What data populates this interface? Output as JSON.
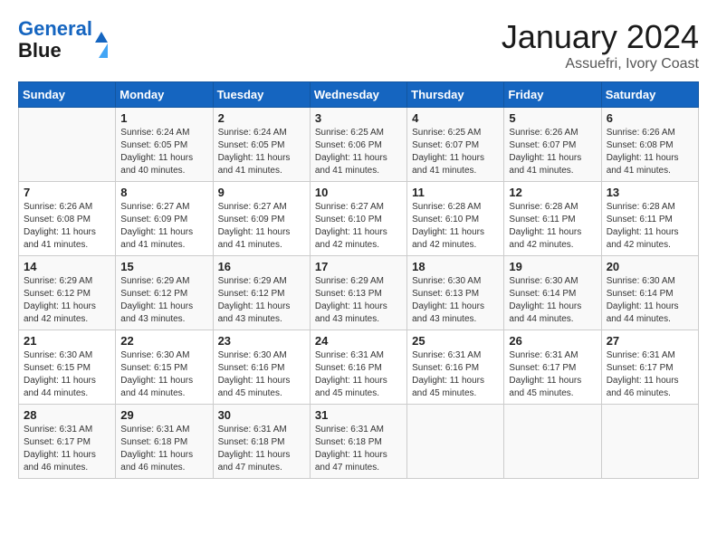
{
  "logo": {
    "line1": "General",
    "line2": "Blue"
  },
  "title": "January 2024",
  "subtitle": "Assuefri, Ivory Coast",
  "headers": [
    "Sunday",
    "Monday",
    "Tuesday",
    "Wednesday",
    "Thursday",
    "Friday",
    "Saturday"
  ],
  "weeks": [
    [
      {
        "day": "",
        "info": ""
      },
      {
        "day": "1",
        "info": "Sunrise: 6:24 AM\nSunset: 6:05 PM\nDaylight: 11 hours\nand 40 minutes."
      },
      {
        "day": "2",
        "info": "Sunrise: 6:24 AM\nSunset: 6:05 PM\nDaylight: 11 hours\nand 41 minutes."
      },
      {
        "day": "3",
        "info": "Sunrise: 6:25 AM\nSunset: 6:06 PM\nDaylight: 11 hours\nand 41 minutes."
      },
      {
        "day": "4",
        "info": "Sunrise: 6:25 AM\nSunset: 6:07 PM\nDaylight: 11 hours\nand 41 minutes."
      },
      {
        "day": "5",
        "info": "Sunrise: 6:26 AM\nSunset: 6:07 PM\nDaylight: 11 hours\nand 41 minutes."
      },
      {
        "day": "6",
        "info": "Sunrise: 6:26 AM\nSunset: 6:08 PM\nDaylight: 11 hours\nand 41 minutes."
      }
    ],
    [
      {
        "day": "7",
        "info": "Sunrise: 6:26 AM\nSunset: 6:08 PM\nDaylight: 11 hours\nand 41 minutes."
      },
      {
        "day": "8",
        "info": "Sunrise: 6:27 AM\nSunset: 6:09 PM\nDaylight: 11 hours\nand 41 minutes."
      },
      {
        "day": "9",
        "info": "Sunrise: 6:27 AM\nSunset: 6:09 PM\nDaylight: 11 hours\nand 41 minutes."
      },
      {
        "day": "10",
        "info": "Sunrise: 6:27 AM\nSunset: 6:10 PM\nDaylight: 11 hours\nand 42 minutes."
      },
      {
        "day": "11",
        "info": "Sunrise: 6:28 AM\nSunset: 6:10 PM\nDaylight: 11 hours\nand 42 minutes."
      },
      {
        "day": "12",
        "info": "Sunrise: 6:28 AM\nSunset: 6:11 PM\nDaylight: 11 hours\nand 42 minutes."
      },
      {
        "day": "13",
        "info": "Sunrise: 6:28 AM\nSunset: 6:11 PM\nDaylight: 11 hours\nand 42 minutes."
      }
    ],
    [
      {
        "day": "14",
        "info": "Sunrise: 6:29 AM\nSunset: 6:12 PM\nDaylight: 11 hours\nand 42 minutes."
      },
      {
        "day": "15",
        "info": "Sunrise: 6:29 AM\nSunset: 6:12 PM\nDaylight: 11 hours\nand 43 minutes."
      },
      {
        "day": "16",
        "info": "Sunrise: 6:29 AM\nSunset: 6:12 PM\nDaylight: 11 hours\nand 43 minutes."
      },
      {
        "day": "17",
        "info": "Sunrise: 6:29 AM\nSunset: 6:13 PM\nDaylight: 11 hours\nand 43 minutes."
      },
      {
        "day": "18",
        "info": "Sunrise: 6:30 AM\nSunset: 6:13 PM\nDaylight: 11 hours\nand 43 minutes."
      },
      {
        "day": "19",
        "info": "Sunrise: 6:30 AM\nSunset: 6:14 PM\nDaylight: 11 hours\nand 44 minutes."
      },
      {
        "day": "20",
        "info": "Sunrise: 6:30 AM\nSunset: 6:14 PM\nDaylight: 11 hours\nand 44 minutes."
      }
    ],
    [
      {
        "day": "21",
        "info": "Sunrise: 6:30 AM\nSunset: 6:15 PM\nDaylight: 11 hours\nand 44 minutes."
      },
      {
        "day": "22",
        "info": "Sunrise: 6:30 AM\nSunset: 6:15 PM\nDaylight: 11 hours\nand 44 minutes."
      },
      {
        "day": "23",
        "info": "Sunrise: 6:30 AM\nSunset: 6:16 PM\nDaylight: 11 hours\nand 45 minutes."
      },
      {
        "day": "24",
        "info": "Sunrise: 6:31 AM\nSunset: 6:16 PM\nDaylight: 11 hours\nand 45 minutes."
      },
      {
        "day": "25",
        "info": "Sunrise: 6:31 AM\nSunset: 6:16 PM\nDaylight: 11 hours\nand 45 minutes."
      },
      {
        "day": "26",
        "info": "Sunrise: 6:31 AM\nSunset: 6:17 PM\nDaylight: 11 hours\nand 45 minutes."
      },
      {
        "day": "27",
        "info": "Sunrise: 6:31 AM\nSunset: 6:17 PM\nDaylight: 11 hours\nand 46 minutes."
      }
    ],
    [
      {
        "day": "28",
        "info": "Sunrise: 6:31 AM\nSunset: 6:17 PM\nDaylight: 11 hours\nand 46 minutes."
      },
      {
        "day": "29",
        "info": "Sunrise: 6:31 AM\nSunset: 6:18 PM\nDaylight: 11 hours\nand 46 minutes."
      },
      {
        "day": "30",
        "info": "Sunrise: 6:31 AM\nSunset: 6:18 PM\nDaylight: 11 hours\nand 47 minutes."
      },
      {
        "day": "31",
        "info": "Sunrise: 6:31 AM\nSunset: 6:18 PM\nDaylight: 11 hours\nand 47 minutes."
      },
      {
        "day": "",
        "info": ""
      },
      {
        "day": "",
        "info": ""
      },
      {
        "day": "",
        "info": ""
      }
    ]
  ]
}
